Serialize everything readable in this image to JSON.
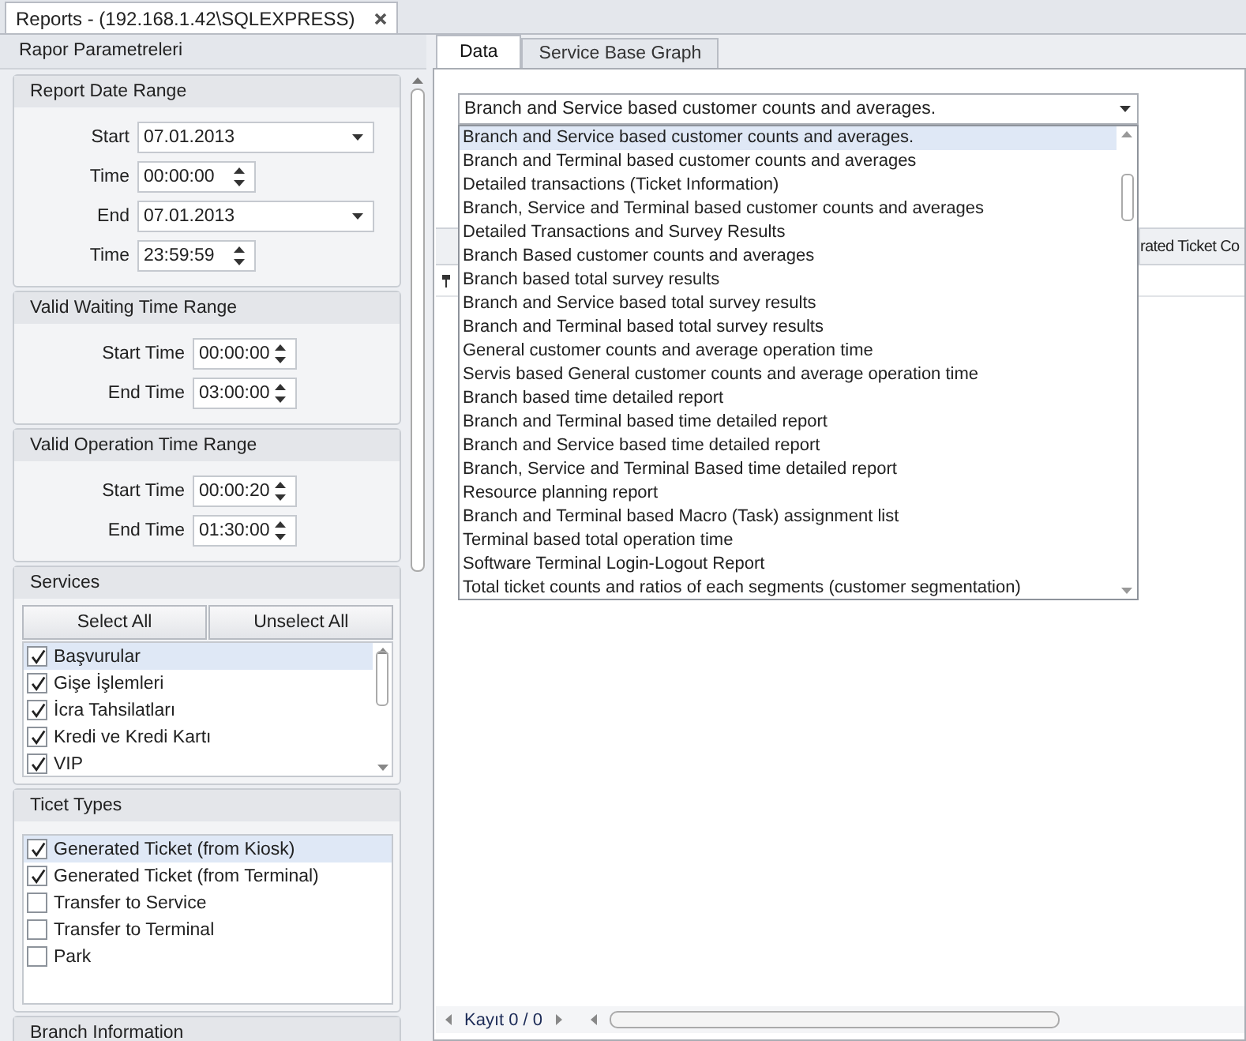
{
  "document_tab": {
    "title": "Reports - (192.168.1.42\\SQLEXPRESS)"
  },
  "left_panel": {
    "title": "Rapor Parametreleri",
    "groups": [
      {
        "kind": "fields",
        "title": "Report Date Range",
        "rows": [
          {
            "kind": "date",
            "label": "Start",
            "value": "07.01.2013"
          },
          {
            "kind": "time",
            "label": "Time",
            "value": "00:00:00"
          },
          {
            "kind": "date",
            "label": "End",
            "value": "07.01.2013"
          },
          {
            "kind": "time",
            "label": "Time",
            "value": "23:59:59"
          }
        ]
      },
      {
        "kind": "fields",
        "title": "Valid Waiting Time Range",
        "rows": [
          {
            "kind": "time",
            "label": "Start Time",
            "value": "00:00:00"
          },
          {
            "kind": "time",
            "label": "End Time",
            "value": "03:00:00"
          }
        ]
      },
      {
        "kind": "fields",
        "title": "Valid Operation Time Range",
        "rows": [
          {
            "kind": "time",
            "label": "Start Time",
            "value": "00:00:20"
          },
          {
            "kind": "time",
            "label": "End Time",
            "value": "01:30:00"
          }
        ]
      },
      {
        "kind": "checklist",
        "title": "Services",
        "buttons": [
          "Select All",
          "Unselect All"
        ],
        "scrollable": true,
        "items": [
          {
            "label": "Başvurular",
            "checked": true,
            "selected": true
          },
          {
            "label": "Gişe İşlemleri",
            "checked": true,
            "selected": false
          },
          {
            "label": "İcra Tahsilatları",
            "checked": true,
            "selected": false
          },
          {
            "label": "Kredi ve Kredi Kartı",
            "checked": true,
            "selected": false
          },
          {
            "label": "VIP",
            "checked": true,
            "selected": false
          }
        ]
      },
      {
        "kind": "checklist",
        "title": "Ticet Types",
        "scrollable": false,
        "items": [
          {
            "label": "Generated Ticket (from Kiosk)",
            "checked": true,
            "selected": true
          },
          {
            "label": "Generated Ticket (from Terminal)",
            "checked": true,
            "selected": false
          },
          {
            "label": "Transfer to Service",
            "checked": false,
            "selected": false
          },
          {
            "label": "Transfer to Terminal",
            "checked": false,
            "selected": false
          },
          {
            "label": "Park",
            "checked": false,
            "selected": false
          }
        ]
      },
      {
        "kind": "header",
        "title": "Branch Information"
      }
    ]
  },
  "right_panel": {
    "tabs": [
      {
        "label": "Data",
        "selected": true
      },
      {
        "label": "Service Base Graph",
        "selected": false
      }
    ],
    "report_combo": {
      "value": "Branch and Service based customer counts and averages.",
      "expanded": true,
      "options": [
        {
          "label": "Branch and Service based customer counts and averages.",
          "selected": true
        },
        {
          "label": "Branch and Terminal based customer counts and averages",
          "selected": false
        },
        {
          "label": "Detailed transactions (Ticket Information)",
          "selected": false
        },
        {
          "label": "Branch, Service and Terminal based customer counts and averages",
          "selected": false
        },
        {
          "label": "Detailed Transactions and Survey Results",
          "selected": false
        },
        {
          "label": "Branch Based customer counts and averages",
          "selected": false
        },
        {
          "label": "Branch based total survey results",
          "selected": false
        },
        {
          "label": "Branch and Service based total survey results",
          "selected": false
        },
        {
          "label": "Branch and Terminal based total survey results",
          "selected": false
        },
        {
          "label": "General customer counts and average operation time",
          "selected": false
        },
        {
          "label": "Servis based General customer counts and average operation time",
          "selected": false
        },
        {
          "label": "Branch based time detailed report",
          "selected": false
        },
        {
          "label": "Branch and Terminal based time detailed report",
          "selected": false
        },
        {
          "label": "Branch and Service based time detailed report",
          "selected": false
        },
        {
          "label": "Branch, Service and Terminal Based time detailed report",
          "selected": false
        },
        {
          "label": "Resource planning report",
          "selected": false
        },
        {
          "label": "Branch and Terminal based Macro (Task) assignment list",
          "selected": false
        },
        {
          "label": "Terminal based total operation time",
          "selected": false
        },
        {
          "label": "Software Terminal Login-Logout Report",
          "selected": false
        },
        {
          "label": "Total ticket counts and ratios of each segments (customer segmentation)",
          "selected": false
        }
      ]
    },
    "grid": {
      "columns": [
        "rated Ticket Co"
      ],
      "navigator": "Kayıt 0 / 0"
    }
  }
}
